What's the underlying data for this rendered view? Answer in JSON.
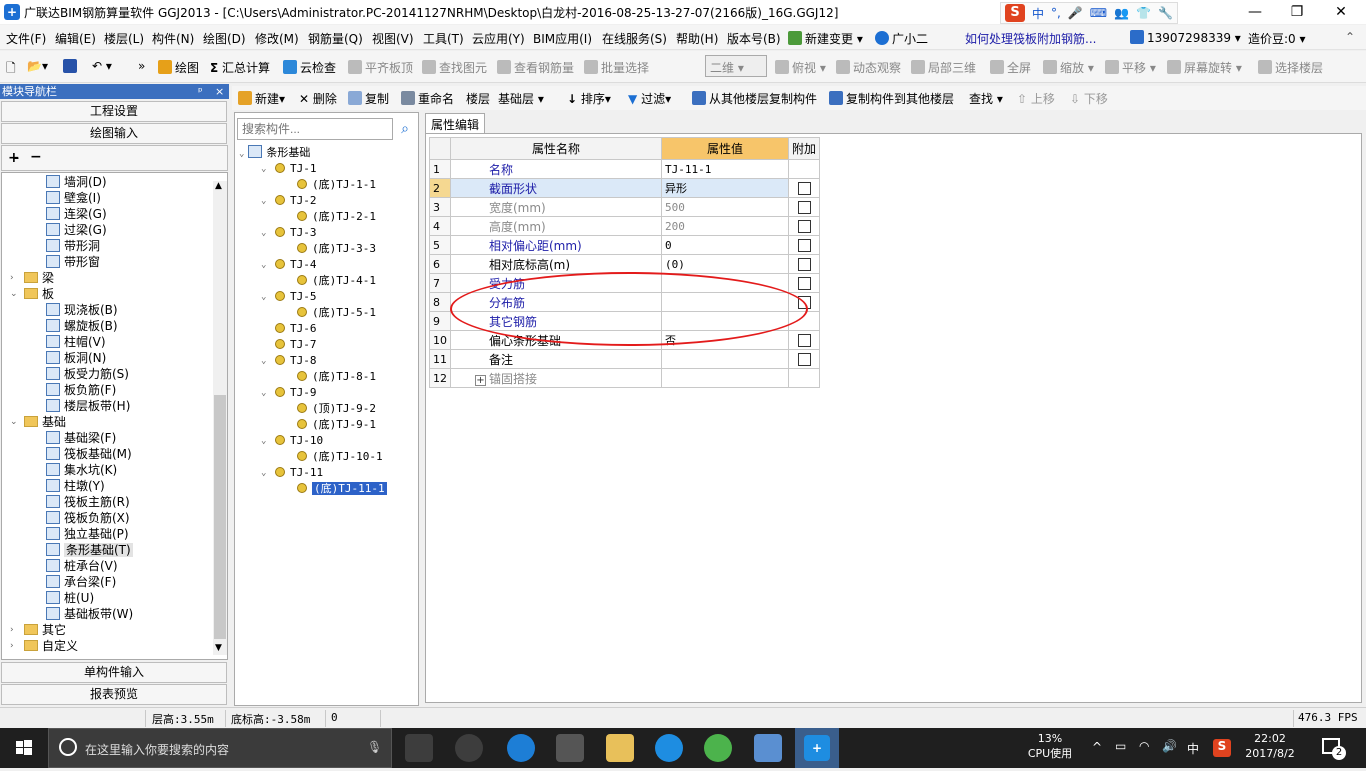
{
  "window": {
    "title": "广联达BIM钢筋算量软件 GGJ2013 - [C:\\Users\\Administrator.PC-20141127NRHM\\Desktop\\白龙村-2016-08-25-13-27-07(2166版)_16G.GGJ12]",
    "ime_labels": [
      "中",
      "°,"
    ]
  },
  "menu": [
    "文件(F)",
    "编辑(E)",
    "楼层(L)",
    "构件(N)",
    "绘图(D)",
    "修改(M)",
    "钢筋量(Q)",
    "视图(V)",
    "工具(T)",
    "云应用(Y)",
    "BIM应用(I)",
    "在线服务(S)",
    "帮助(H)",
    "版本号(B)",
    "新建变更",
    "广小二",
    "如何处理筏板附加钢筋...",
    "13907298339",
    "造价豆:0"
  ],
  "toolbar": {
    "draw": "绘图",
    "sum_calc": "汇总计算",
    "cloud_check": "云检查",
    "flush_slab": "平齐板顶",
    "find_element": "查找图元",
    "view_rebar": "查看钢筋量",
    "batch_select": "批量选择",
    "view_mode": "二维",
    "top_view": "俯视",
    "dynamic_view": "动态观察",
    "local_3d": "局部三维",
    "fullscreen": "全屏",
    "zoom": "缩放",
    "pan": "平移",
    "rotate": "屏幕旋转",
    "select_floor": "选择楼层"
  },
  "left_panel": {
    "header": "模块导航栏",
    "project_settings": "工程设置",
    "drawing_input": "绘图输入",
    "single_input": "单构件输入",
    "report_preview": "报表预览",
    "tree": [
      {
        "label": "墙洞(D)",
        "kind": "item"
      },
      {
        "label": "壁龛(I)",
        "kind": "item"
      },
      {
        "label": "连梁(G)",
        "kind": "item"
      },
      {
        "label": "过梁(G)",
        "kind": "item"
      },
      {
        "label": "带形洞",
        "kind": "item"
      },
      {
        "label": "带形窗",
        "kind": "item"
      },
      {
        "label": "梁",
        "kind": "folder"
      },
      {
        "label": "板",
        "kind": "folder"
      },
      {
        "label": "现浇板(B)",
        "kind": "item"
      },
      {
        "label": "螺旋板(B)",
        "kind": "item"
      },
      {
        "label": "柱帽(V)",
        "kind": "item"
      },
      {
        "label": "板洞(N)",
        "kind": "item"
      },
      {
        "label": "板受力筋(S)",
        "kind": "item"
      },
      {
        "label": "板负筋(F)",
        "kind": "item"
      },
      {
        "label": "楼层板带(H)",
        "kind": "item"
      },
      {
        "label": "基础",
        "kind": "folder"
      },
      {
        "label": "基础梁(F)",
        "kind": "item"
      },
      {
        "label": "筏板基础(M)",
        "kind": "item"
      },
      {
        "label": "集水坑(K)",
        "kind": "item"
      },
      {
        "label": "柱墩(Y)",
        "kind": "item"
      },
      {
        "label": "筏板主筋(R)",
        "kind": "item"
      },
      {
        "label": "筏板负筋(X)",
        "kind": "item"
      },
      {
        "label": "独立基础(P)",
        "kind": "item"
      },
      {
        "label": "条形基础(T)",
        "kind": "item"
      },
      {
        "label": "桩承台(V)",
        "kind": "item"
      },
      {
        "label": "承台梁(F)",
        "kind": "item"
      },
      {
        "label": "桩(U)",
        "kind": "item"
      },
      {
        "label": "基础板带(W)",
        "kind": "item"
      },
      {
        "label": "其它",
        "kind": "folder"
      },
      {
        "label": "自定义",
        "kind": "folder"
      }
    ]
  },
  "component_toolbar": {
    "new": "新建",
    "delete": "删除",
    "copy": "复制",
    "rename": "重命名",
    "floor": "楼层",
    "floor_value": "基础层",
    "sort": "排序",
    "filter": "过滤",
    "copy_from_floor": "从其他楼层复制构件",
    "copy_to_floor": "复制构件到其他楼层",
    "find": "查找",
    "move_up": "上移",
    "move_down": "下移"
  },
  "component_list": {
    "search_placeholder": "搜索构件...",
    "root": "条形基础",
    "items": [
      {
        "label": "TJ-1",
        "children": [
          "(底)TJ-1-1"
        ]
      },
      {
        "label": "TJ-2",
        "children": [
          "(底)TJ-2-1"
        ]
      },
      {
        "label": "TJ-3",
        "children": [
          "(底)TJ-3-3"
        ]
      },
      {
        "label": "TJ-4",
        "children": [
          "(底)TJ-4-1"
        ]
      },
      {
        "label": "TJ-5",
        "children": [
          "(底)TJ-5-1"
        ]
      },
      {
        "label": "TJ-6",
        "children": []
      },
      {
        "label": "TJ-7",
        "children": []
      },
      {
        "label": "TJ-8",
        "children": [
          "(底)TJ-8-1"
        ]
      },
      {
        "label": "TJ-9",
        "children": [
          "(顶)TJ-9-2",
          "(底)TJ-9-1"
        ]
      },
      {
        "label": "TJ-10",
        "children": [
          "(底)TJ-10-1"
        ]
      },
      {
        "label": "TJ-11",
        "children": [
          "(底)TJ-11-1"
        ]
      }
    ]
  },
  "properties": {
    "tab": "属性编辑",
    "col_name": "属性名称",
    "col_value": "属性值",
    "col_add": "附加",
    "rows": [
      {
        "idx": "1",
        "name": "名称",
        "value": "TJ-11-1",
        "style": "blue",
        "check": false
      },
      {
        "idx": "2",
        "name": "截面形状",
        "value": "异形",
        "style": "blue",
        "check": true,
        "selected": true
      },
      {
        "idx": "3",
        "name": "宽度(mm)",
        "value": "500",
        "style": "gray",
        "check": true
      },
      {
        "idx": "4",
        "name": "高度(mm)",
        "value": "200",
        "style": "gray",
        "check": true
      },
      {
        "idx": "5",
        "name": "相对偏心距(mm)",
        "value": "0",
        "style": "blue",
        "check": true
      },
      {
        "idx": "6",
        "name": "相对底标高(m)",
        "value": "(0)",
        "style": "normal",
        "check": true
      },
      {
        "idx": "7",
        "name": "受力筋",
        "value": "",
        "style": "blue",
        "check": true
      },
      {
        "idx": "8",
        "name": "分布筋",
        "value": "",
        "style": "blue",
        "check": true
      },
      {
        "idx": "9",
        "name": "其它钢筋",
        "value": "",
        "style": "blue",
        "check": false
      },
      {
        "idx": "10",
        "name": "偏心条形基础",
        "value": "否",
        "style": "normal",
        "check": true
      },
      {
        "idx": "11",
        "name": "备注",
        "value": "",
        "style": "normal",
        "check": true
      },
      {
        "idx": "12",
        "name": "锚固搭接",
        "value": "",
        "style": "gray",
        "check": false,
        "expand": true
      }
    ]
  },
  "status": {
    "floor_height": "层高:3.55m",
    "bottom_elev": "底标高:-3.58m",
    "zero": "0",
    "fps": "476.3 FPS"
  },
  "taskbar": {
    "search_placeholder": "在这里输入你要搜索的内容",
    "cpu_percent": "13%",
    "cpu_label": "CPU使用",
    "ime": "中",
    "time": "22:02",
    "date": "2017/8/2",
    "notif_count": "2"
  }
}
